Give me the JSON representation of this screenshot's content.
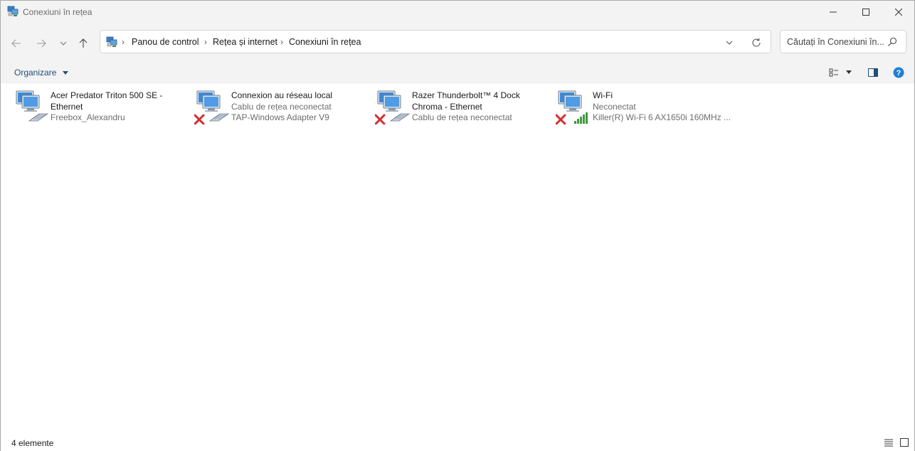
{
  "window": {
    "title": "Conexiuni în rețea"
  },
  "controls": {
    "minimize": "minimize-icon",
    "maximize": "maximize-icon",
    "close": "close-icon"
  },
  "address": {
    "breadcrumbs": [
      "Panou de control",
      "Rețea și internet",
      "Conexiuni în rețea"
    ],
    "search_placeholder": "Căutați în Conexiuni în..."
  },
  "toolbar": {
    "organize_label": "Organizare"
  },
  "connections": [
    {
      "name": "Acer Predator Triton 500 SE - Ethernet",
      "line2": "Freebox_Alexandru",
      "line3": "",
      "icon": "ethernet-connected-icon",
      "disconnected": false
    },
    {
      "name": "Connexion au réseau local",
      "line2": "Cablu de rețea neconectat",
      "line3": "TAP-Windows Adapter V9",
      "icon": "ethernet-disconnected-icon",
      "disconnected": true
    },
    {
      "name": "Razer Thunderbolt™ 4 Dock Chroma - Ethernet",
      "line2": "Cablu de rețea neconectat",
      "line3": "",
      "icon": "ethernet-disconnected-icon",
      "disconnected": true
    },
    {
      "name": "Wi-Fi",
      "line2": "Neconectat",
      "line3": "Killer(R) Wi-Fi 6 AX1650i 160MHz ...",
      "icon": "wifi-disconnected-icon",
      "disconnected": true
    }
  ],
  "status": {
    "count": "4 elemente"
  },
  "colors": {
    "accent": "#1f4e79",
    "error_red": "#d32f2f",
    "help_blue": "#1e7fd6"
  }
}
